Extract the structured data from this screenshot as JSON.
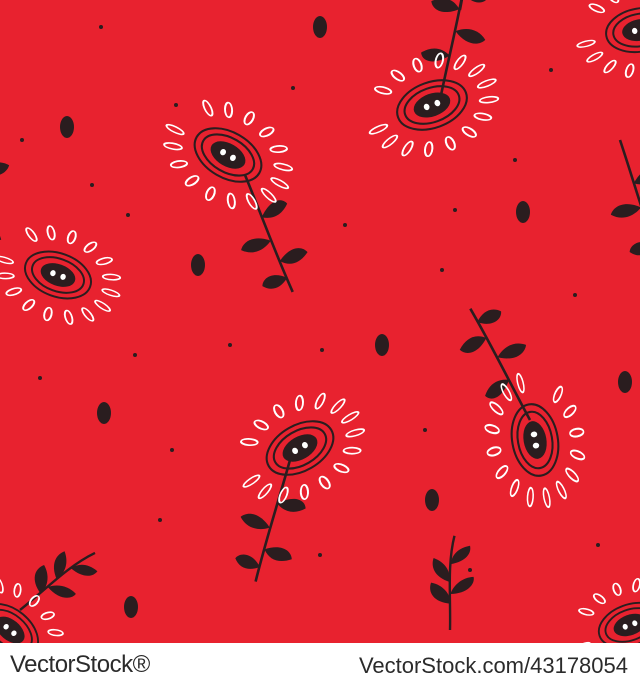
{
  "pattern": {
    "background_color": "#e8222f",
    "ink_color": "#2a1d1f",
    "petal_color": "#ffffff",
    "motif": "folk-style flowers with stems, leaves and seeds"
  },
  "footer": {
    "brand_part1": "Vector",
    "brand_part2": "Stock",
    "brand_suffix": "®",
    "image_id": "VectorStock.com/43178054"
  }
}
